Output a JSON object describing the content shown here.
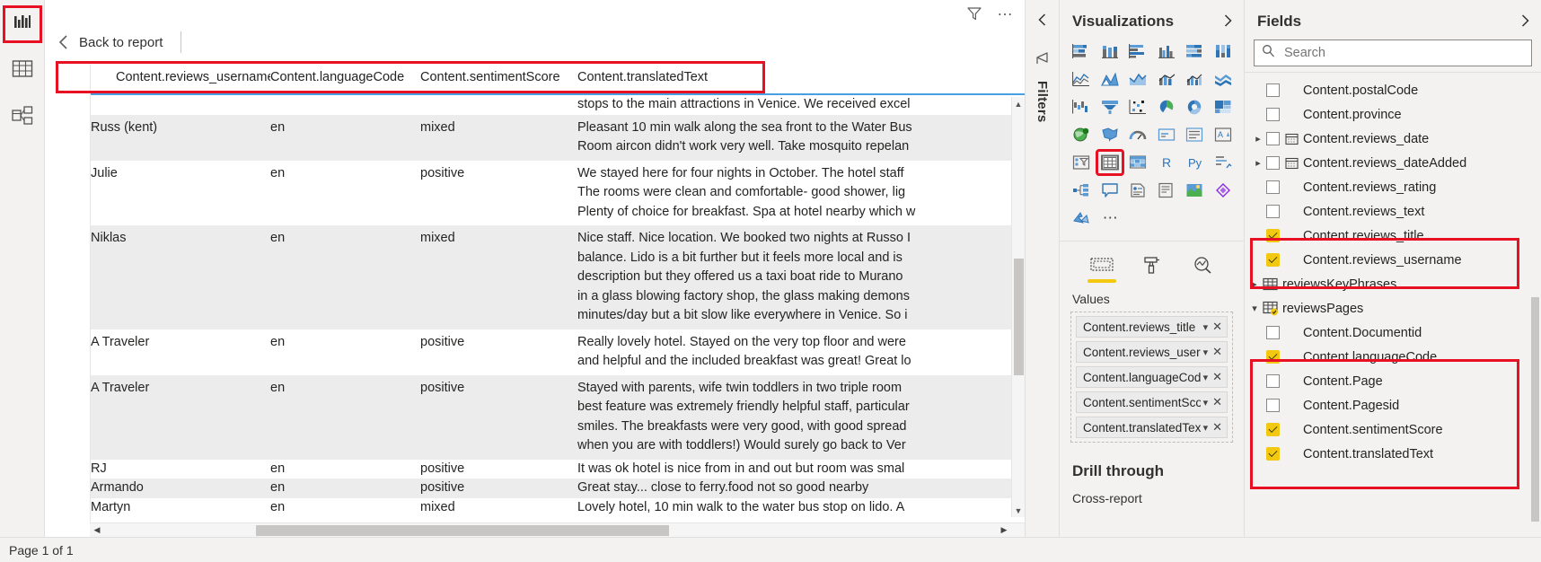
{
  "left_rail": {
    "items": [
      {
        "name": "report-view",
        "icon": "bar-chart-icon",
        "selected": true
      },
      {
        "name": "data-view",
        "icon": "table-grid-icon",
        "selected": false
      },
      {
        "name": "model-view",
        "icon": "model-relationship-icon",
        "selected": false
      }
    ]
  },
  "canvas": {
    "filter_icon": "funnel-icon",
    "more_options": "…",
    "back_label": "Back to report",
    "back_icon": "chevron-left-icon"
  },
  "table": {
    "columns": [
      "Content.reviews_username",
      "Content.languageCode",
      "Content.sentimentScore",
      "Content.translatedText"
    ],
    "rows": [
      {
        "left_trunc": "",
        "username": "",
        "language": "",
        "sentiment": "",
        "translated": "stops to the main attractions in Venice. We received excel",
        "stripe": "odd",
        "partial_top": true
      },
      {
        "left_trunc": "",
        "username": "Russ (kent)",
        "language": "en",
        "sentiment": "mixed",
        "translated": "Pleasant 10 min walk along the sea front to the Water Bus\nRoom aircon didn't work very well. Take mosquito repelan",
        "stripe": "even"
      },
      {
        "left_trunc": "",
        "username": "Julie",
        "language": "en",
        "sentiment": "positive",
        "translated": "We stayed here for four nights in October. The hotel staff\nThe rooms were clean and comfortable- good shower, lig\nPlenty of choice for breakfast. Spa at hotel nearby which w",
        "stripe": "odd"
      },
      {
        "left_trunc": "",
        "username": "Niklas",
        "language": "en",
        "sentiment": "mixed",
        "translated": "Nice staff. Nice location. We booked two nights at Russo I\nbalance. Lido is a bit further but it feels more local and is \ndescription but they offered us a taxi boat ride to Murano\nin a glass blowing factory shop, the glass making demons\nminutes/day but a bit slow like everywhere in Venice. So i",
        "stripe": "even"
      },
      {
        "left_trunc": "",
        "username": "A Traveler",
        "language": "en",
        "sentiment": "positive",
        "translated": "Really lovely hotel. Stayed on the very top floor and were\nand helpful and the included breakfast was great! Great lo",
        "stripe": "odd"
      },
      {
        "left_trunc": "",
        "username": "A Traveler",
        "language": "en",
        "sentiment": "positive",
        "translated": "Stayed with parents, wife twin toddlers in two triple room\nbest feature was extremely friendly helpful staff, particular\nsmiles. The breakfasts were very good, with good spread \nwhen you are with toddlers!) Would surely go back to Ver",
        "stripe": "even"
      },
      {
        "left_trunc": "m",
        "username": "RJ",
        "language": "en",
        "sentiment": "positive",
        "translated": "It was ok hotel is nice from in and out but room was smal",
        "stripe": "odd"
      },
      {
        "left_trunc": "",
        "username": "Armando",
        "language": "en",
        "sentiment": "positive",
        "translated": "Great stay... close to ferry.food not so good nearby",
        "stripe": "even"
      },
      {
        "left_trunc": ".",
        "username": "Martyn",
        "language": "en",
        "sentiment": "mixed",
        "translated": "Lovely hotel, 10 min walk to the water bus stop on lido. A",
        "stripe": "odd"
      }
    ]
  },
  "filters": {
    "collapse_icon": "chevron-left-icon",
    "flag_icon": "filter-flag-icon",
    "label": "Filters"
  },
  "visualizations": {
    "title": "Visualizations",
    "expand_icon": "chevron-right-icon",
    "icons": [
      "stacked-bar-chart-icon",
      "stacked-column-chart-icon",
      "clustered-bar-chart-icon",
      "clustered-column-chart-icon",
      "hundred-percent-stacked-bar-icon",
      "hundred-percent-stacked-column-icon",
      "line-chart-icon",
      "area-chart-icon",
      "stacked-area-chart-icon",
      "line-stacked-column-icon",
      "line-clustered-column-icon",
      "ribbon-chart-icon",
      "waterfall-chart-icon",
      "funnel-chart-icon",
      "scatter-chart-icon",
      "pie-chart-icon",
      "donut-chart-icon",
      "treemap-icon",
      "map-icon",
      "filled-map-icon",
      "gauge-icon",
      "card-icon",
      "multi-row-card-icon",
      "kpi-icon",
      "slicer-icon",
      "table-icon",
      "matrix-icon",
      "r-script-visual-icon",
      "python-visual-icon",
      "key-influencers-icon",
      "decomposition-tree-icon",
      "qna-icon",
      "smart-narrative-icon",
      "paginated-report-icon",
      "arcgis-map-icon",
      "power-apps-icon",
      "azure-map-icon",
      "more-visuals-icon"
    ],
    "selected_icon": "table-icon",
    "tabs": [
      {
        "name": "fields-tab",
        "icon": "fields-well-icon",
        "active": true
      },
      {
        "name": "format-tab",
        "icon": "paint-roller-icon",
        "active": false
      },
      {
        "name": "analytics-tab",
        "icon": "magnifier-analytics-icon",
        "active": false
      }
    ],
    "values_label": "Values",
    "values_fields": [
      {
        "label": "Content.reviews_title",
        "chevron": "chevron-down-icon",
        "remove": "close-icon"
      },
      {
        "label": "Content.reviews_usernam",
        "chevron": "chevron-down-icon",
        "remove": "close-icon"
      },
      {
        "label": "Content.languageCode",
        "chevron": "chevron-down-icon",
        "remove": "close-icon"
      },
      {
        "label": "Content.sentimentScore",
        "chevron": "chevron-down-icon",
        "remove": "close-icon"
      },
      {
        "label": "Content.translatedText",
        "chevron": "chevron-down-icon",
        "remove": "close-icon"
      }
    ],
    "drill_through_title": "Drill through",
    "drill_through_sub": "Cross-report"
  },
  "fields": {
    "title": "Fields",
    "expand_icon": "chevron-right-icon",
    "search_placeholder": "Search",
    "search_value": "",
    "search_icon": "search-icon",
    "items": [
      {
        "label": "Content.postalCode",
        "checked": false,
        "expandable": false,
        "icon": null,
        "indent": 1
      },
      {
        "label": "Content.province",
        "checked": false,
        "expandable": false,
        "icon": null,
        "indent": 1
      },
      {
        "label": "Content.reviews_date",
        "checked": false,
        "expandable": true,
        "icon": "calendar-icon",
        "indent": 1
      },
      {
        "label": "Content.reviews_dateAdded",
        "checked": false,
        "expandable": true,
        "icon": "calendar-icon",
        "indent": 1
      },
      {
        "label": "Content.reviews_rating",
        "checked": false,
        "expandable": false,
        "icon": null,
        "indent": 1
      },
      {
        "label": "Content.reviews_text",
        "checked": false,
        "expandable": false,
        "icon": null,
        "indent": 1
      },
      {
        "label": "Content.reviews_title",
        "checked": true,
        "expandable": false,
        "icon": null,
        "indent": 1
      },
      {
        "label": "Content.reviews_username",
        "checked": true,
        "expandable": false,
        "icon": null,
        "indent": 1
      },
      {
        "label": "reviewsKeyPhrases",
        "checked": false,
        "expandable": true,
        "icon": "table-icon",
        "indent": 0,
        "is_table": true,
        "expanded": false
      },
      {
        "label": "reviewsPages",
        "checked": false,
        "expandable": true,
        "icon": "table-checked-icon",
        "indent": 0,
        "is_table": true,
        "expanded": true
      },
      {
        "label": "Content.Documentid",
        "checked": false,
        "expandable": false,
        "icon": null,
        "indent": 1
      },
      {
        "label": "Content.languageCode",
        "checked": true,
        "expandable": false,
        "icon": null,
        "indent": 1
      },
      {
        "label": "Content.Page",
        "checked": false,
        "expandable": false,
        "icon": null,
        "indent": 1
      },
      {
        "label": "Content.Pagesid",
        "checked": false,
        "expandable": false,
        "icon": null,
        "indent": 1
      },
      {
        "label": "Content.sentimentScore",
        "checked": true,
        "expandable": false,
        "icon": null,
        "indent": 1
      },
      {
        "label": "Content.translatedText",
        "checked": true,
        "expandable": false,
        "icon": null,
        "indent": 1
      }
    ]
  },
  "statusbar": {
    "page_text": "Page 1 of 1"
  },
  "colors": {
    "annotation_red": "#e81123",
    "powerbi_yellow": "#f2c811",
    "pane_bg": "#f3f2f1",
    "header_underline": "#4a9fe0",
    "row_stripe": "#ececec"
  }
}
